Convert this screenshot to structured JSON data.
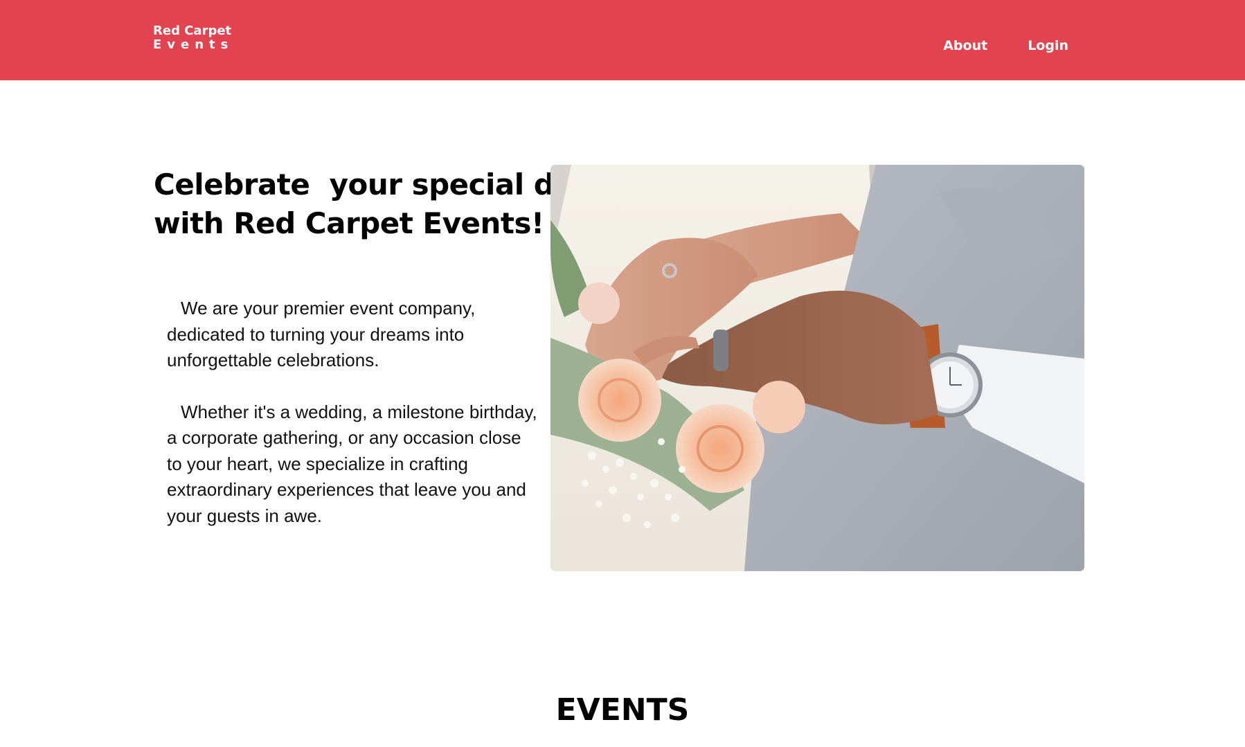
{
  "header": {
    "brand_line1": "Red Carpet",
    "brand_line2": "Events",
    "nav": [
      {
        "label": "About"
      },
      {
        "label": "Login"
      }
    ],
    "background_color": "#e24350"
  },
  "hero": {
    "title_line1": "Celebrate  your special day",
    "title_line2": "with Red Carpet Events!",
    "paragraph1": "We are your premier event company, dedicated to turning your dreams into unforgettable celebrations.",
    "paragraph2": "Whether it's a wedding, a milestone birthday, a corporate gathering, or any occasion close to your heart, we specialize in crafting extraordinary experiences that leave you and your guests in awe.",
    "photo_icon": "wedding-hands-photo"
  },
  "events": {
    "heading": "EVENTS"
  }
}
